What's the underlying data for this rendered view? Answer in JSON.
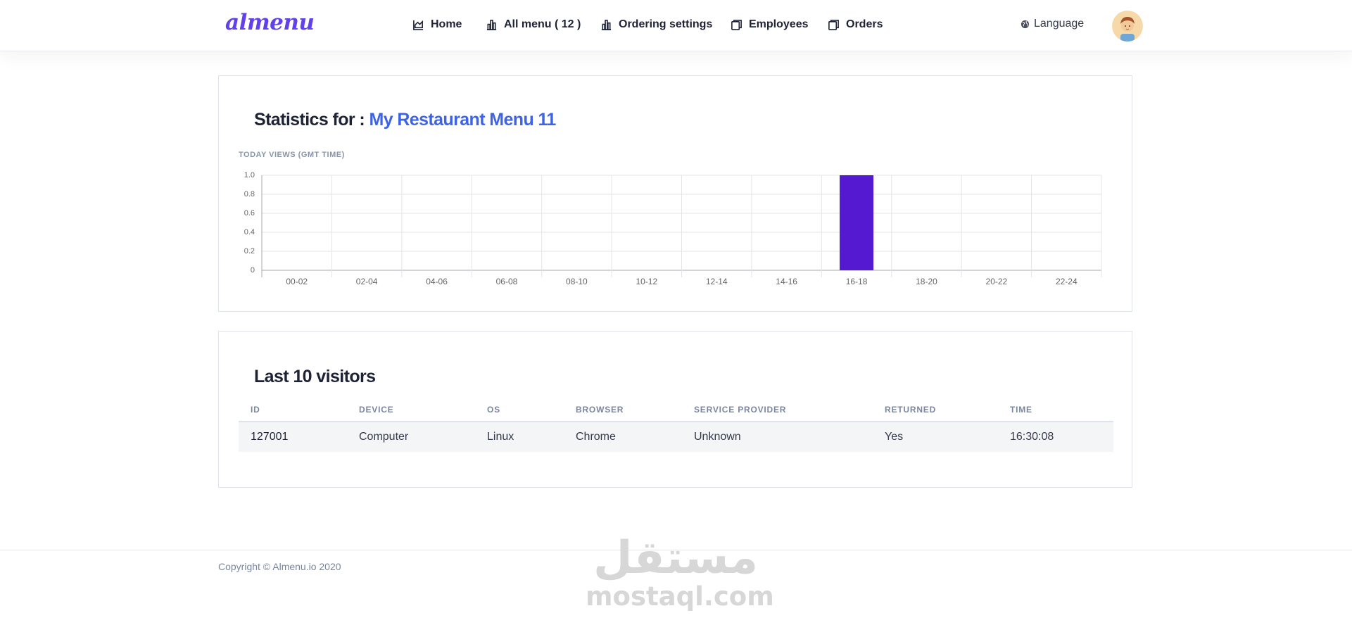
{
  "brand": {
    "logo_text": "almenu",
    "accent": "#6241ea"
  },
  "nav": {
    "items": [
      {
        "label": "Home",
        "icon": "area-chart-icon"
      },
      {
        "label": "All menu ( 12 )",
        "icon": "bar-chart-icon"
      },
      {
        "label": "Ordering settings",
        "icon": "bar-chart-icon"
      },
      {
        "label": "Employees",
        "icon": "copy-icon"
      },
      {
        "label": "Orders",
        "icon": "copy-icon"
      }
    ],
    "language_label": "Language",
    "language_icon": "globe-icon",
    "avatar_icon": "user-avatar-icon"
  },
  "stats": {
    "title_prefix": "Statistics for :",
    "menu_name": "My Restaurant Menu 11",
    "menu_name_color": "#3d63e6"
  },
  "chart_data": {
    "type": "bar",
    "title": "TODAY VIEWS (GMT TIME)",
    "categories": [
      "00-02",
      "02-04",
      "04-06",
      "06-08",
      "08-10",
      "10-12",
      "12-14",
      "14-16",
      "16-18",
      "18-20",
      "20-22",
      "22-24"
    ],
    "values": [
      0,
      0,
      0,
      0,
      0,
      0,
      0,
      0,
      1,
      0,
      0,
      0
    ],
    "ylim": [
      0,
      1
    ],
    "yticks": [
      "0",
      "0.2",
      "0.4",
      "0.6",
      "0.8",
      "1.0"
    ],
    "grid": true,
    "bar_color": "#5519d2"
  },
  "visitors": {
    "title": "Last 10 visitors",
    "columns": [
      "ID",
      "DEVICE",
      "OS",
      "BROWSER",
      "SERVICE PROVIDER",
      "RETURNED",
      "TIME"
    ],
    "rows": [
      {
        "id": "127001",
        "device": "Computer",
        "os": "Linux",
        "browser": "Chrome",
        "provider": "Unknown",
        "returned": "Yes",
        "time": "16:30:08"
      }
    ]
  },
  "footer": {
    "copyright": "Copyright © Almenu.io 2020"
  },
  "watermark": {
    "arabic": "مستقل",
    "latin": "mostaql.com"
  }
}
